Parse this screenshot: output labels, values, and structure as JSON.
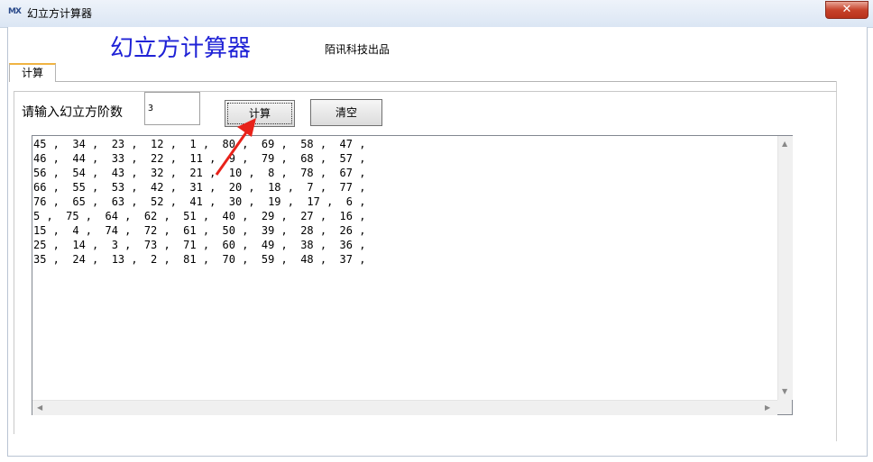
{
  "window": {
    "title": "幻立方计算器",
    "icon_text": "MX",
    "close_label": "✕"
  },
  "header": {
    "title": "幻立方计算器",
    "subtitle": "陌讯科技出品"
  },
  "tabs": [
    {
      "label": "计算",
      "active": true
    }
  ],
  "form": {
    "order_label": "请输入幻立方阶数",
    "order_value": "3",
    "calc_label": "计算",
    "clear_label": "清空"
  },
  "output": {
    "lines": [
      "45 ,  34 ,  23 ,  12 ,  1 ,  80 ,  69 ,  58 ,  47 ,",
      "46 ,  44 ,  33 ,  22 ,  11 ,  9 ,  79 ,  68 ,  57 ,",
      "56 ,  54 ,  43 ,  32 ,  21 ,  10 ,  8 ,  78 ,  67 ,",
      "66 ,  55 ,  53 ,  42 ,  31 ,  20 ,  18 ,  7 ,  77 ,",
      "76 ,  65 ,  63 ,  52 ,  41 ,  30 ,  19 ,  17 ,  6 ,",
      "5 ,  75 ,  64 ,  62 ,  51 ,  40 ,  29 ,  27 ,  16 ,",
      "15 ,  4 ,  74 ,  72 ,  61 ,  50 ,  39 ,  28 ,  26 ,",
      "25 ,  14 ,  3 ,  73 ,  71 ,  60 ,  49 ,  38 ,  36 ,",
      "35 ,  24 ,  13 ,  2 ,  81 ,  70 ,  59 ,  48 ,  37 ,"
    ]
  },
  "annotation": {
    "arrow_color": "#e8221a"
  }
}
